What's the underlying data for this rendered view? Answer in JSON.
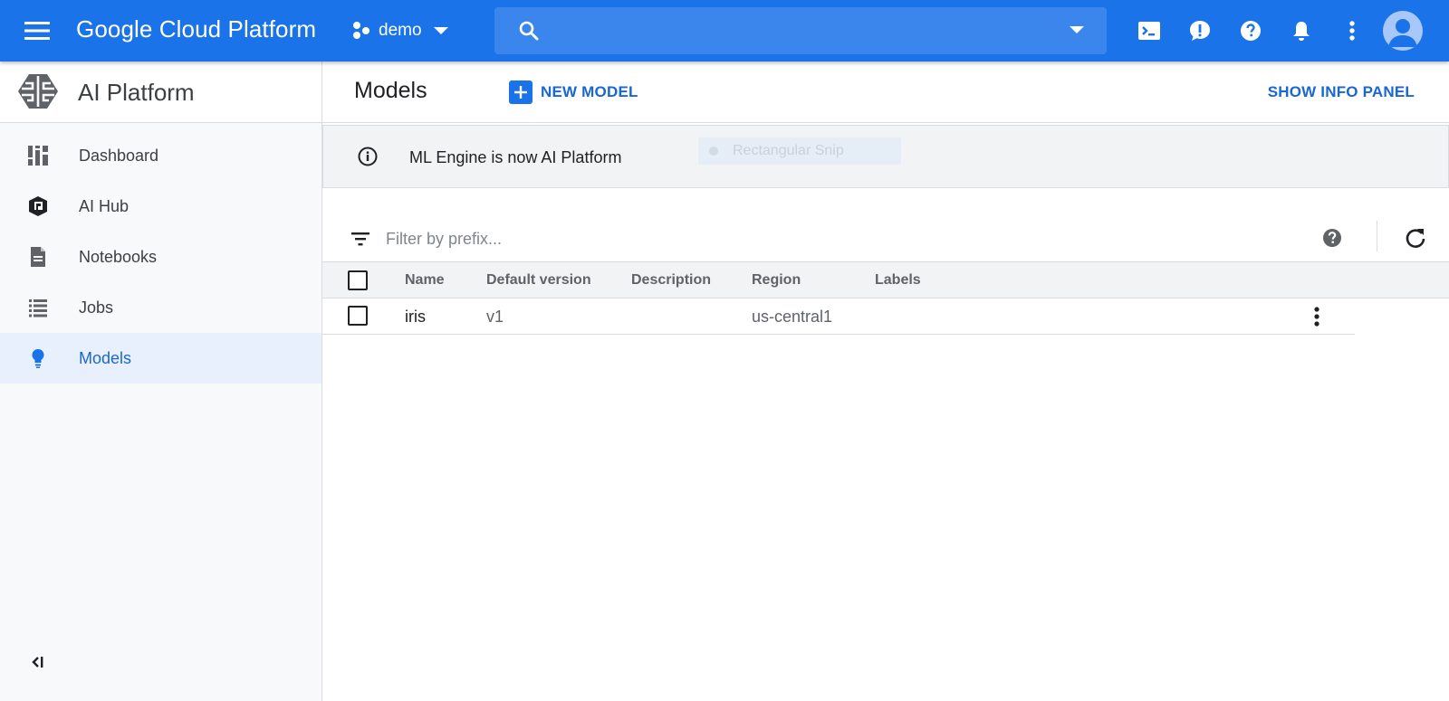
{
  "topbar": {
    "brand": "Google Cloud Platform",
    "project": "demo",
    "search_placeholder": ""
  },
  "sidebar": {
    "title": "AI Platform",
    "items": [
      {
        "label": "Dashboard",
        "icon": "dashboard-icon"
      },
      {
        "label": "AI Hub",
        "icon": "ai-hub-icon"
      },
      {
        "label": "Notebooks",
        "icon": "notebook-icon"
      },
      {
        "label": "Jobs",
        "icon": "jobs-list-icon"
      },
      {
        "label": "Models",
        "icon": "lightbulb-icon",
        "active": true
      }
    ]
  },
  "main": {
    "title": "Models",
    "new_model_label": "NEW MODEL",
    "info_panel_label": "SHOW INFO PANEL",
    "banner_text": "ML Engine is now AI Platform",
    "snip_overlay_text": "Rectangular Snip",
    "filter_placeholder": "Filter by prefix...",
    "table": {
      "columns": [
        "Name",
        "Default version",
        "Description",
        "Region",
        "Labels"
      ],
      "rows": [
        {
          "name": "iris",
          "default_version": "v1",
          "description": "",
          "region": "us-central1",
          "labels": ""
        }
      ]
    }
  },
  "colors": {
    "topbar": "#1a73e8",
    "accent_text": "#1967d2",
    "active_nav_bg": "#e8f0fe"
  }
}
